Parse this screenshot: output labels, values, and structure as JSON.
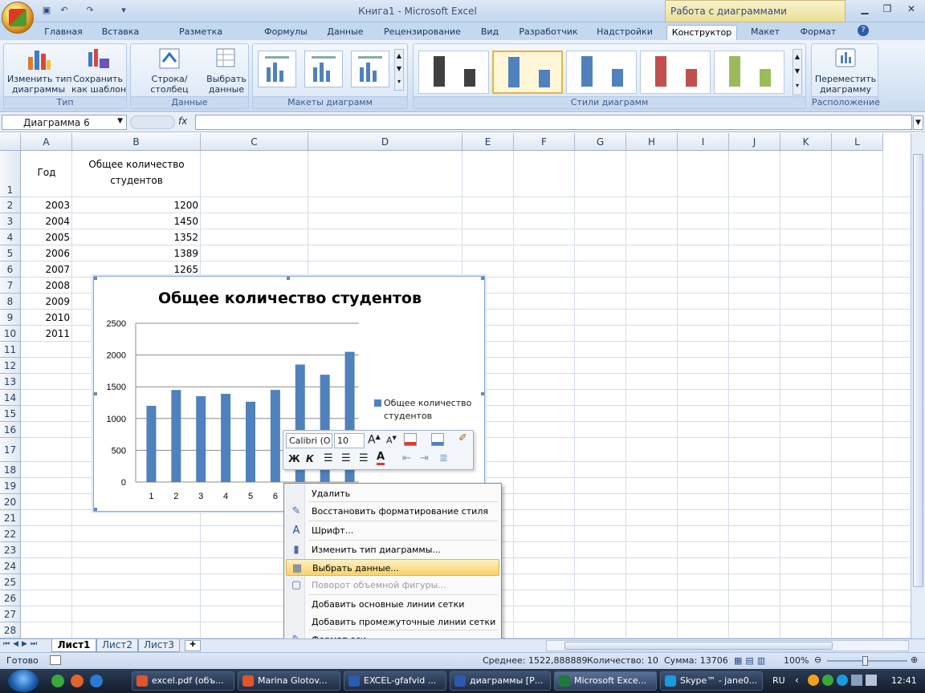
{
  "window": {
    "title": "Книга1 - Microsoft Excel",
    "context_title": "Работа с диаграммами"
  },
  "tabs": [
    "Главная",
    "Вставка",
    "Разметка страницы",
    "Формулы",
    "Данные",
    "Рецензирование",
    "Вид",
    "Разработчик",
    "Надстройки",
    "Конструктор",
    "Макет",
    "Формат"
  ],
  "active_tab": "Конструктор",
  "ribbon": {
    "type_group": {
      "label": "Тип",
      "change_type": "Изменить тип\nдиаграммы",
      "save_template": "Сохранить\nкак шаблон"
    },
    "data_group": {
      "label": "Данные",
      "row_col": "Строка/столбец",
      "select_data": "Выбрать\nданные"
    },
    "layouts_group": {
      "label": "Макеты диаграмм"
    },
    "styles_group": {
      "label": "Стили диаграмм",
      "styles": [
        {
          "color": "#404040"
        },
        {
          "color": "#4f81bd"
        },
        {
          "color": "#4f81bd"
        },
        {
          "color": "#c0504d"
        },
        {
          "color": "#9bbb59"
        }
      ]
    },
    "location_group": {
      "label": "Расположение",
      "move_chart": "Переместить\nдиаграмму"
    }
  },
  "formula_bar": {
    "name_box": "Диаграмма 6",
    "fx": "fx",
    "formula": ""
  },
  "sheet": {
    "columns": [
      "A",
      "B",
      "C",
      "D",
      "E",
      "F",
      "G",
      "H",
      "I",
      "J",
      "K",
      "L"
    ],
    "rows": [
      "1",
      "2",
      "3",
      "4",
      "5",
      "6",
      "7",
      "8",
      "9",
      "10",
      "11",
      "12",
      "13",
      "14",
      "15",
      "16",
      "17",
      "18",
      "19",
      "20",
      "21",
      "22",
      "23",
      "24",
      "25",
      "26",
      "27",
      "28"
    ],
    "header_a": "Год",
    "header_b_line1": "Общее количество",
    "header_b_line2": "студентов",
    "years": [
      "2003",
      "2004",
      "2005",
      "2006",
      "2007",
      "2008",
      "2009",
      "2010",
      "2011"
    ],
    "counts": [
      "1200",
      "1450",
      "1352",
      "1389",
      "1265"
    ]
  },
  "chart_data": {
    "type": "bar",
    "title": "Общее количество студентов",
    "categories": [
      "1",
      "2",
      "3",
      "4",
      "5",
      "6",
      "7",
      "8",
      "9"
    ],
    "series": [
      {
        "name": "Общее количество студентов",
        "values": [
          1200,
          1450,
          1352,
          1389,
          1265,
          1450,
          1850,
          1690,
          2050
        ]
      }
    ],
    "ylim": [
      0,
      2500
    ],
    "yticks": [
      "0",
      "500",
      "1000",
      "1500",
      "2000",
      "2500"
    ],
    "grid": true,
    "legend": "right",
    "color": "#4f81bd"
  },
  "mini_toolbar": {
    "font": "Calibri (О",
    "size": "10",
    "bold": "Ж",
    "italic": "К"
  },
  "context_menu": {
    "items": [
      {
        "label": "Удалить",
        "icon": "",
        "disabled": false,
        "highlighted": false
      },
      {
        "label": "Восстановить форматирование стиля",
        "icon": "✎",
        "disabled": false,
        "highlighted": false
      },
      {
        "label": "Шрифт...",
        "icon": "A",
        "disabled": false,
        "highlighted": false
      },
      {
        "label": "Изменить тип диаграммы...",
        "icon": "▮",
        "disabled": false,
        "highlighted": false
      },
      {
        "label": "Выбрать данные...",
        "icon": "▦",
        "disabled": false,
        "highlighted": true
      },
      {
        "label": "Поворот объемной фигуры...",
        "icon": "▢",
        "disabled": true,
        "highlighted": false
      },
      {
        "label": "Добавить основные линии сетки",
        "icon": "",
        "disabled": false,
        "highlighted": false
      },
      {
        "label": "Добавить промежуточные линии сетки",
        "icon": "",
        "disabled": false,
        "highlighted": false
      },
      {
        "label": "Формат оси...",
        "icon": "✎",
        "disabled": false,
        "highlighted": false
      }
    ]
  },
  "sheet_tabs": [
    "Лист1",
    "Лист2",
    "Лист3"
  ],
  "status": {
    "ready": "Готово",
    "average": "Среднее: 1522,888889",
    "count": "Количество: 10",
    "sum": "Сумма: 13706",
    "zoom": "100%"
  },
  "taskbar": {
    "buttons": [
      {
        "label": "excel.pdf (объ...",
        "color": "#e0562b"
      },
      {
        "label": "Marina Glotov...",
        "color": "#e0562b"
      },
      {
        "label": "EXCEL-gfafvid ...",
        "color": "#2b5ab0"
      },
      {
        "label": "диаграммы [Р...",
        "color": "#2b5ab0"
      },
      {
        "label": "Microsoft Exce...",
        "color": "#1f7a3a"
      },
      {
        "label": "Skype™ - jane0...",
        "color": "#1a9bde"
      }
    ],
    "lang": "RU",
    "time": "12:41"
  }
}
